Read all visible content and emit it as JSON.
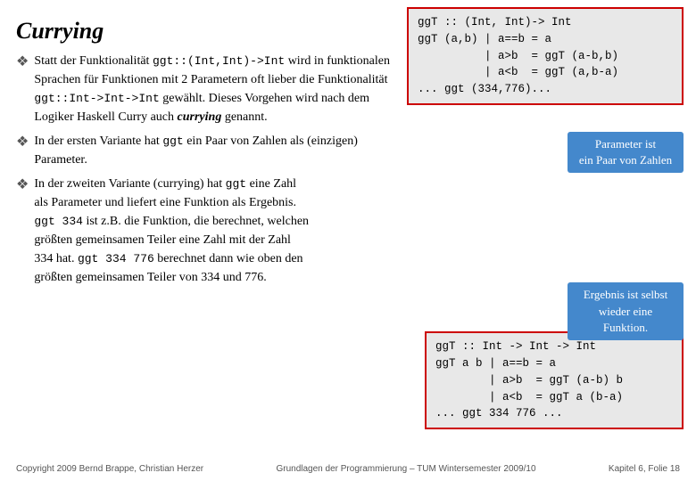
{
  "title": "Currying",
  "code_box1": {
    "lines": [
      "ggT :: (Int, Int)-> Int",
      "ggT (a,b) | a==b = a",
      "          | a>b  = ggT (a-b,b)",
      "          | a<b  = ggT (a,b-a)",
      "... ggt (334,776)..."
    ]
  },
  "code_box2": {
    "lines": [
      "ggT :: Int -> Int -> Int",
      "ggT a b | a==b = a",
      "        | a>b  = ggT (a-b) b",
      "        | a<b  = ggT a (b-a)",
      "... ggt 334 776 ..."
    ]
  },
  "tooltip1": {
    "text": "Parameter ist\nein Paar von Zahlen"
  },
  "tooltip2": {
    "text": "Ergebnis ist selbst\nwieder eine Funktion."
  },
  "bullet1": {
    "prefix": "Statt der Funktionalität ",
    "code1": "ggt::(Int,Int)->Int",
    "middle": " wird in funktionalen Sprachen für Funktionen mit 2 Parametern oft lieber die Funktionalität ",
    "code2": "ggt::Int->Int->Int",
    "suffix": " gewählt. Dieses Vorgehen wird nach dem Logiker Haskell Curry auch ",
    "italic": "currying",
    "end": " genannt."
  },
  "bullet2": {
    "text": "In der ersten Variante hat ",
    "code": "ggt",
    "text2": " ein Paar von Zahlen als (einzigen) Parameter."
  },
  "bullet3": {
    "text1": "In der zweiten Variante (currying) hat ",
    "code1": "ggt",
    "text2": " eine Zahl als Parameter und liefert eine Funktion als Ergebnis. ",
    "code2": "ggt 334",
    "text3": " ist z.B. die Funktion, die berechnet, welchen größten gemeinsamen Teiler eine Zahl mit der Zahl 334 hat. ",
    "code3": "ggt 334 776",
    "text4": " berechnet dann wie oben den größten gemeinsamen Teiler von 334 und 776."
  },
  "footer": {
    "copyright": "Copyright 2009 Bernd Brappe, Christian Herzer",
    "center": "Grundlagen der Programmierung – TUM Wintersemester 2009/10",
    "right": "Kapitel 6, Folie 18"
  }
}
